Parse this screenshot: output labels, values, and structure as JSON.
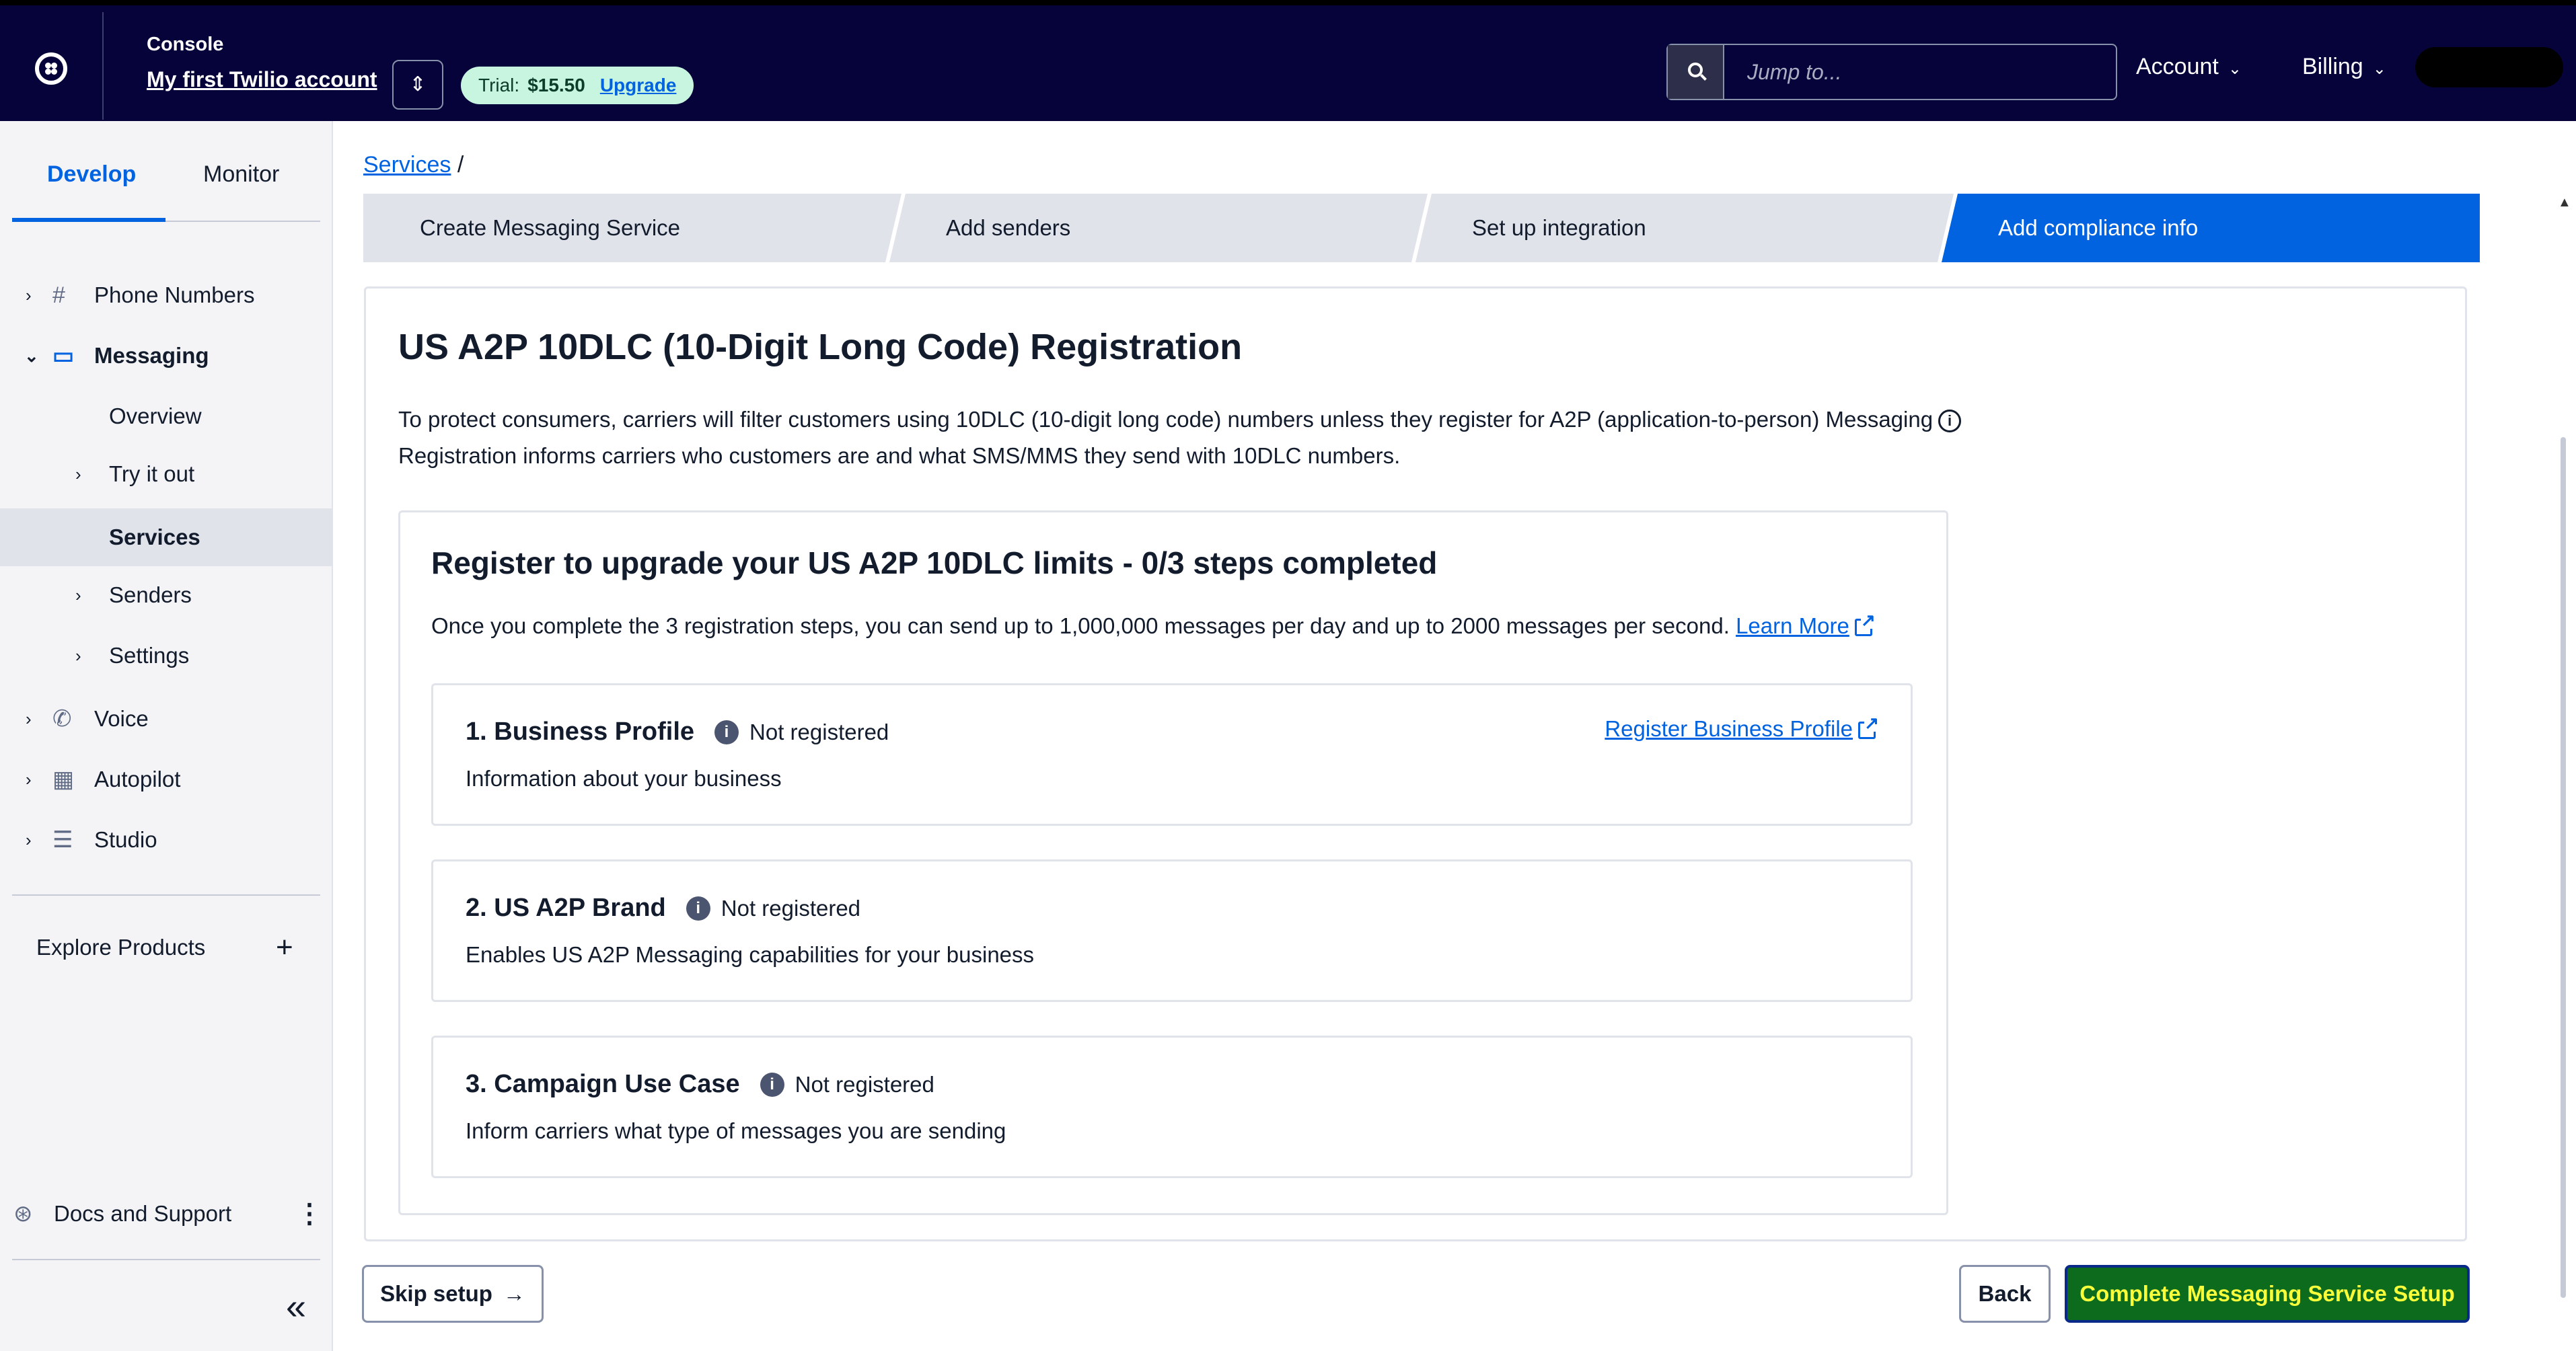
{
  "topbar": {
    "console_label": "Console",
    "account_name": "My first Twilio account",
    "trial_label": "Trial:",
    "trial_amount": "$15.50",
    "upgrade_label": "Upgrade",
    "search_placeholder": "Jump to...",
    "menu_account": "Account",
    "menu_billing": "Billing",
    "colors": {
      "bar": "#06033a",
      "pill": "#c8f5df"
    }
  },
  "sidebar": {
    "tabs": [
      "Develop",
      "Monitor"
    ],
    "active_tab": "Develop",
    "items": [
      {
        "label": "Phone Numbers",
        "icon": "hash-icon"
      },
      {
        "label": "Messaging",
        "icon": "chat-icon",
        "expanded": true
      },
      {
        "label": "Overview"
      },
      {
        "label": "Try it out"
      },
      {
        "label": "Services",
        "selected": true
      },
      {
        "label": "Senders"
      },
      {
        "label": "Settings"
      },
      {
        "label": "Voice",
        "icon": "phone-icon"
      },
      {
        "label": "Autopilot",
        "icon": "autopilot-icon"
      },
      {
        "label": "Studio",
        "icon": "studio-icon"
      }
    ],
    "explore": "Explore Products",
    "docs": "Docs and Support"
  },
  "main": {
    "breadcrumb": {
      "link": "Services",
      "sep": "/"
    },
    "steps": [
      "Create Messaging Service",
      "Add senders",
      "Set up integration",
      "Add compliance info"
    ],
    "active_step": "Add compliance info",
    "title": "US A2P 10DLC (10-Digit Long Code) Registration",
    "desc_line1": "To protect consumers, carriers will filter customers using 10DLC (10-digit long code) numbers unless they register for A2P (application-to-person) Messaging",
    "desc_line2": "Registration informs carriers who customers are and what SMS/MMS they send with 10DLC numbers.",
    "register": {
      "title": "Register to upgrade your US A2P 10DLC limits - 0/3 steps completed",
      "desc": "Once you complete the 3 registration steps, you can send up to 1,000,000 messages per day and up to 2000 messages per second.",
      "learn_more": "Learn More",
      "items": [
        {
          "title": "1. Business Profile",
          "status": "Not registered",
          "desc": "Information about your business",
          "link": "Register Business Profile"
        },
        {
          "title": "2. US A2P Brand",
          "status": "Not registered",
          "desc": "Enables US A2P Messaging capabilities for your business"
        },
        {
          "title": "3. Campaign Use Case",
          "status": "Not registered",
          "desc": "Inform carriers what type of messages you are sending"
        }
      ]
    },
    "buttons": {
      "skip": "Skip setup",
      "back": "Back",
      "complete": "Complete Messaging Service Setup"
    },
    "accent": "#0263e0"
  }
}
